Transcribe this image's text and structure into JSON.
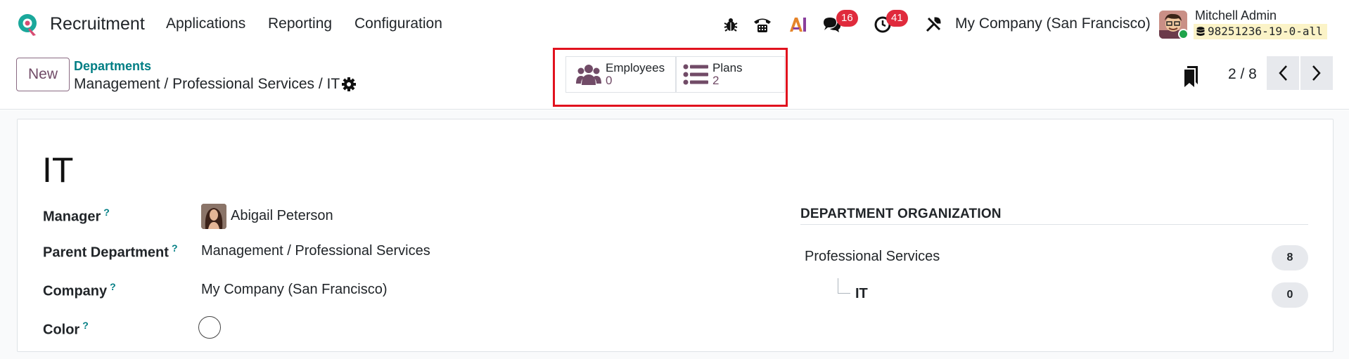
{
  "navbar": {
    "app_name": "Recruitment",
    "menu": [
      "Applications",
      "Reporting",
      "Configuration"
    ],
    "messages_count": "16",
    "activities_count": "41",
    "company": "My Company (San Francisco)",
    "user_name": "Mitchell Admin",
    "database": "98251236-19-0-all",
    "icons": [
      "bug-icon",
      "phone-icon",
      "ai-icon",
      "messages-icon",
      "activity-clock-icon",
      "tools-icon",
      "database-icon"
    ]
  },
  "control": {
    "new_label": "New",
    "breadcrumb_parent": "Departments",
    "breadcrumb_current": "Management / Professional Services / IT",
    "smart_buttons": [
      {
        "label": "Employees",
        "value": "0",
        "icon": "users-icon"
      },
      {
        "label": "Plans",
        "value": "2",
        "icon": "list-icon"
      }
    ],
    "pager": "2 / 8"
  },
  "form": {
    "title": "IT",
    "fields": [
      {
        "label": "Manager",
        "help": "?",
        "value": "Abigail Peterson"
      },
      {
        "label": "Parent Department",
        "help": "?",
        "value": "Management / Professional Services"
      },
      {
        "label": "Company",
        "help": "?",
        "value": "My Company (San Francisco)"
      },
      {
        "label": "Color",
        "help": "?",
        "value": ""
      }
    ],
    "org": {
      "title": "DEPARTMENT ORGANIZATION",
      "rows": [
        {
          "name": "Professional Services",
          "count": "8"
        },
        {
          "name": "IT",
          "count": "0"
        }
      ]
    }
  },
  "colors": {
    "brand": "#714b67",
    "link": "#017e84",
    "badge": "#e02a3c",
    "highlight": "#e1121e"
  }
}
